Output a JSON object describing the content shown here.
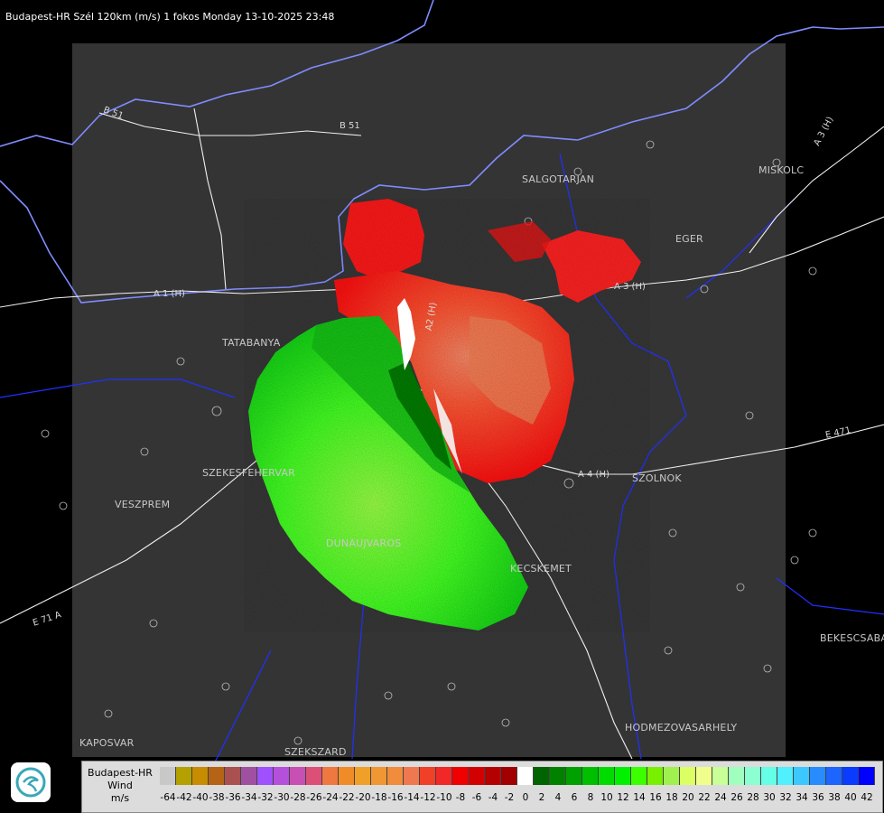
{
  "header": {
    "title": "Budapest-HR Szél 120km (m/s) 1 fokos Monday 13-10-2025 23:48"
  },
  "map": {
    "cities": [
      {
        "id": "salgotarjan",
        "label": "SALGOTARJAN"
      },
      {
        "id": "eger",
        "label": "EGER"
      },
      {
        "id": "miskolc",
        "label": "MISKOLC"
      },
      {
        "id": "tatabanya",
        "label": "TATABANYA"
      },
      {
        "id": "szekesfehervar",
        "label": "SZEKESFEHERVAR"
      },
      {
        "id": "veszprem",
        "label": "VESZPREM"
      },
      {
        "id": "dunaujvaros",
        "label": "DUNAUJVAROS"
      },
      {
        "id": "kecskemet",
        "label": "KECSKEMET"
      },
      {
        "id": "szolnok",
        "label": "SZOLNOK"
      },
      {
        "id": "bekescsaba",
        "label": "BEKESCSABA"
      },
      {
        "id": "hodmezovasarhely",
        "label": "HODMEZOVASARHELY"
      },
      {
        "id": "kaposvar",
        "label": "KAPOSVAR"
      },
      {
        "id": "szekszard",
        "label": "SZEKSZARD"
      }
    ],
    "roads": [
      {
        "id": "b51a",
        "label": "B 51"
      },
      {
        "id": "b51b",
        "label": "B 51"
      },
      {
        "id": "a1",
        "label": "A 1 (H)"
      },
      {
        "id": "a3",
        "label": "A 3 (H)"
      },
      {
        "id": "a3ne",
        "label": "A 3 (H)"
      },
      {
        "id": "a4",
        "label": "A 4 (H)"
      },
      {
        "id": "a2",
        "label": "A2 (H)"
      },
      {
        "id": "e71",
        "label": "E 71 A"
      },
      {
        "id": "e471",
        "label": "E 471"
      }
    ]
  },
  "legend": {
    "title_line1": "Budapest-HR",
    "title_line2": "Wind",
    "unit": "m/s",
    "ticks": [
      "-64",
      "-42",
      "-40",
      "-38",
      "-36",
      "-34",
      "-32",
      "-30",
      "-28",
      "-26",
      "-24",
      "-22",
      "-20",
      "-18",
      "-16",
      "-14",
      "-12",
      "-10",
      "-8",
      "-6",
      "-4",
      "-2",
      "0",
      "2",
      "4",
      "6",
      "8",
      "10",
      "12",
      "14",
      "16",
      "18",
      "20",
      "22",
      "24",
      "26",
      "28",
      "30",
      "32",
      "34",
      "36",
      "38",
      "40",
      "42"
    ],
    "colors": [
      "#c8c8c8",
      "#b4a000",
      "#c88c00",
      "#b46414",
      "#aa5050",
      "#a050a0",
      "#a050ff",
      "#b450dc",
      "#c850b4",
      "#dc5078",
      "#ef7840",
      "#f08c28",
      "#f0a028",
      "#f09632",
      "#f08c3c",
      "#f07850",
      "#f04028",
      "#f02828",
      "#f00000",
      "#d20000",
      "#b40000",
      "#a00000",
      "#ffffff",
      "#006400",
      "#008200",
      "#00a000",
      "#00be00",
      "#00dc00",
      "#00f000",
      "#3cff00",
      "#78f000",
      "#a0f050",
      "#dcff64",
      "#f0ff8c",
      "#c8ff96",
      "#a0ffbe",
      "#8cffd2",
      "#64ffe6",
      "#50f0ff",
      "#3cc8ff",
      "#288cff",
      "#1e64ff",
      "#0a3cff",
      "#0000ff"
    ]
  }
}
